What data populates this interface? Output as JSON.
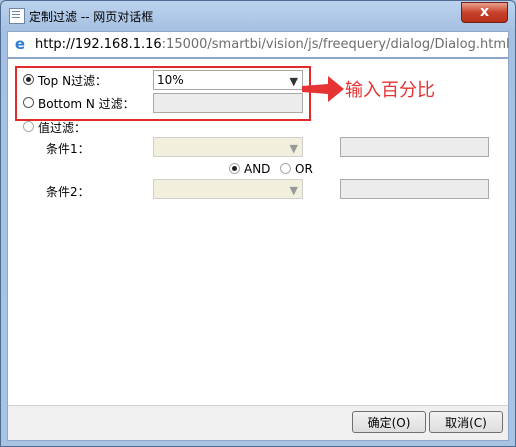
{
  "window": {
    "title": "定制过滤 -- 网页对话框",
    "close_glyph": "x",
    "url_host": "http://192.168.1.16",
    "url_path": ":15000/smartbi/vision/js/freequery/dialog/Dialog.html"
  },
  "form": {
    "topn": {
      "label": "Top N过滤：",
      "value": "10%",
      "checked": true
    },
    "bottomn": {
      "label": "Bottom N 过滤：",
      "value": "",
      "checked": false
    },
    "valuefilter": {
      "label": "值过滤：",
      "condition1_label": "条件1：",
      "condition2_label": "条件2：",
      "and_label": "AND",
      "or_label": "OR",
      "and_checked": true
    }
  },
  "annotation": {
    "text": "输入百分比",
    "color": "#e63232"
  },
  "footer": {
    "ok_label": "确定(O)",
    "cancel_label": "取消(C)"
  },
  "icons": {
    "app": "document-icon",
    "browser": "ie-icon",
    "dropdown": "chevron-down-icon"
  }
}
